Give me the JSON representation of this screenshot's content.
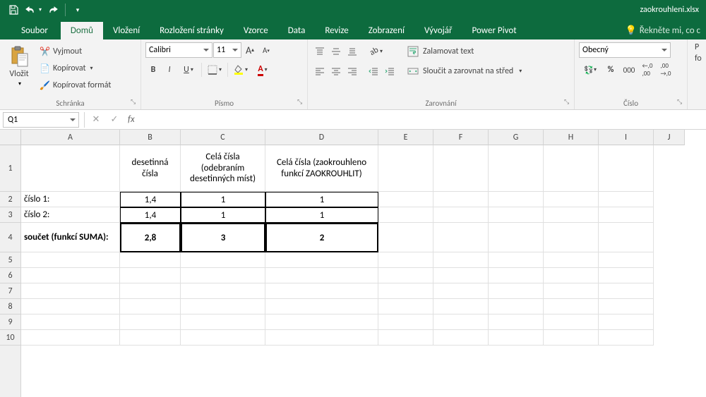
{
  "titlebar": {
    "filename": "zaokrouhleni.xlsx"
  },
  "tabs": {
    "file": "Soubor",
    "home": "Domů",
    "insert": "Vložení",
    "layout": "Rozložení stránky",
    "formulas": "Vzorce",
    "data": "Data",
    "review": "Revize",
    "view": "Zobrazení",
    "developer": "Vývojář",
    "powerpivot": "Power Pivot",
    "tell": "Řekněte mi, co c"
  },
  "ribbon": {
    "clipboard": {
      "label": "Schránka",
      "paste": "Vložit",
      "cut": "Vyjmout",
      "copy": "Kopírovat",
      "format": "Kopírovat formát"
    },
    "font": {
      "label": "Písmo",
      "name": "Calibri",
      "size": "11"
    },
    "alignment": {
      "label": "Zarovnání",
      "wrap": "Zalamovat text",
      "merge": "Sloučit a zarovnat na střed"
    },
    "number": {
      "label": "Číslo",
      "format": "Obecný"
    },
    "format": {
      "cond": "P",
      "fo": "fo"
    }
  },
  "fx": {
    "name": "Q1",
    "value": ""
  },
  "cols": {
    "w": {
      "A": 140,
      "B": 86,
      "C": 120,
      "D": 160,
      "E": 78,
      "F": 78,
      "G": 78,
      "H": 78,
      "I": 78,
      "J": 30
    }
  },
  "colHdrs": [
    "A",
    "B",
    "C",
    "D",
    "E",
    "F",
    "G",
    "H",
    "I",
    "J"
  ],
  "rowH": {
    "r1": 66,
    "r4": 42
  },
  "sheet": {
    "b1": "desetinná čísla",
    "c1": "Celá čísla (odebraním desetinných míst)",
    "d1": "Celá čísla (zaokrouhleno funkcí ZAOKROUHLIT)",
    "a2": "číslo 1:",
    "b2": "1,4",
    "c2": "1",
    "d2": "1",
    "a3": "číslo 2:",
    "b3": "1,4",
    "c3": "1",
    "d3": "1",
    "a4": "součet (funkcí SUMA):",
    "b4": "2,8",
    "c4": "3",
    "d4": "2"
  }
}
